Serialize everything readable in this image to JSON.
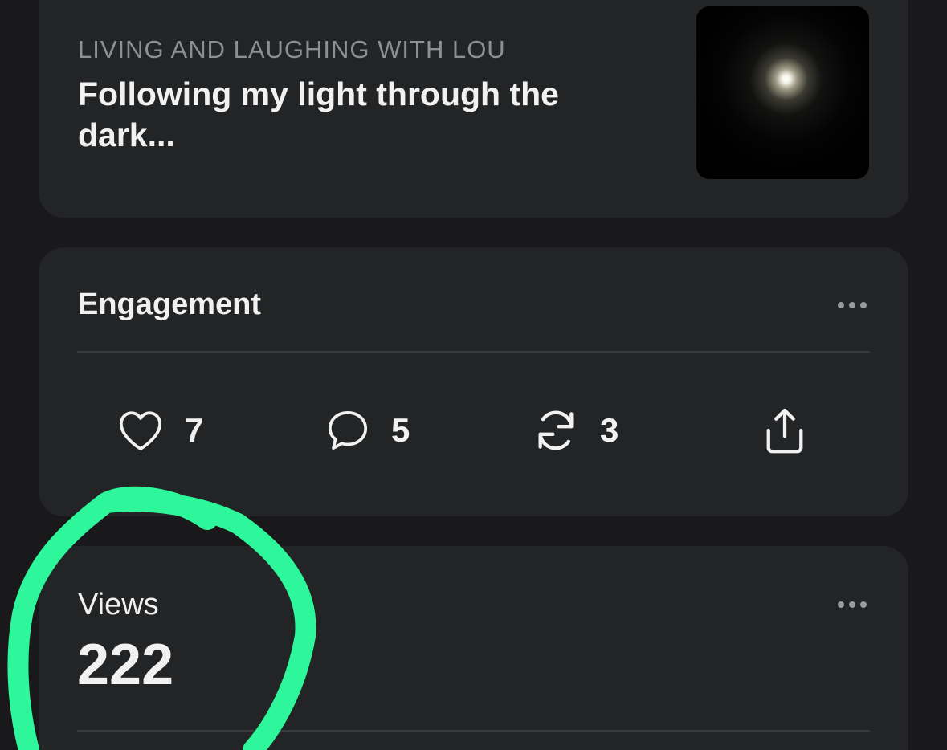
{
  "post": {
    "publication": "LIVING AND LAUGHING WITH LOU",
    "title": "Following my light through the dark..."
  },
  "engagement": {
    "title": "Engagement",
    "likes": "7",
    "comments": "5",
    "restacks": "3"
  },
  "views": {
    "label": "Views",
    "value": "222"
  },
  "colors": {
    "background": "#19191b",
    "card": "#232425",
    "text": "#f1f1f1",
    "muted": "#8e8f91",
    "annotation": "#2df79a"
  },
  "icons": [
    "heart-icon",
    "comment-icon",
    "restack-icon",
    "share-icon",
    "more-icon"
  ]
}
